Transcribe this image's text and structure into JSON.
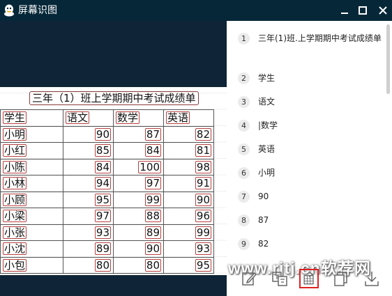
{
  "window": {
    "title": "屏幕识图",
    "controls": {
      "minimize": "minimize-icon",
      "maximize": "maximize-icon",
      "close": "close-icon"
    }
  },
  "sheet": {
    "title": "三年（1）班上学期期中考试成绩单",
    "headers": [
      "学生",
      "语文",
      "数学",
      "英语"
    ],
    "rows": [
      [
        "小明",
        "90",
        "87",
        "82"
      ],
      [
        "小红",
        "85",
        "84",
        "81"
      ],
      [
        "小陈",
        "84",
        "100",
        "98"
      ],
      [
        "小林",
        "94",
        "97",
        "91"
      ],
      [
        "小顾",
        "95",
        "99",
        "90"
      ],
      [
        "小梁",
        "97",
        "88",
        "96"
      ],
      [
        "小张",
        "93",
        "89",
        "99"
      ],
      [
        "小沈",
        "89",
        "90",
        "93"
      ],
      [
        "小包",
        "80",
        "80",
        "95"
      ]
    ]
  },
  "results": [
    {
      "n": "1",
      "text": "三年(1)班.上学期期中考试成绩单"
    },
    {
      "n": "2",
      "text": "学生"
    },
    {
      "n": "3",
      "text": "语文"
    },
    {
      "n": "4",
      "text": "|数学"
    },
    {
      "n": "5",
      "text": "英语"
    },
    {
      "n": "6",
      "text": "小明"
    },
    {
      "n": "7",
      "text": "90"
    },
    {
      "n": "8",
      "text": "87"
    },
    {
      "n": "9",
      "text": "82"
    }
  ],
  "toolbar": [
    "edit-icon",
    "translate-icon",
    "export-excel-icon",
    "copy-icon",
    "download-icon"
  ],
  "watermark": "www.rjtj.cn软荐网",
  "colors": {
    "titlebar": "#062738",
    "background": "#0f2436",
    "highlight": "#e02020"
  }
}
